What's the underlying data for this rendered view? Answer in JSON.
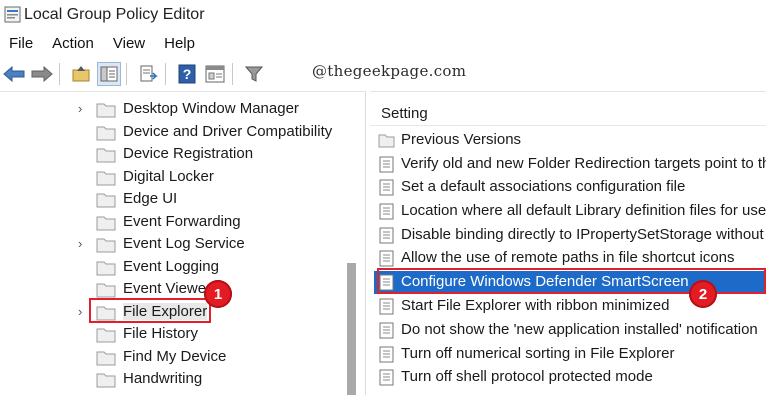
{
  "window": {
    "title": "Local Group Policy Editor"
  },
  "menu": [
    "File",
    "Action",
    "View",
    "Help"
  ],
  "toolbar": {
    "buttons": [
      "back-arrow-icon",
      "forward-arrow-icon",
      "up-folder-icon",
      "show-hide-tree-icon",
      "export-list-icon",
      "help-icon",
      "properties-icon",
      "filter-icon"
    ]
  },
  "watermark": "@thegeekpage.com",
  "tree": {
    "items": [
      {
        "label": "Desktop Window Manager",
        "expandable": true
      },
      {
        "label": "Device and Driver Compatibility",
        "expandable": false
      },
      {
        "label": "Device Registration",
        "expandable": false
      },
      {
        "label": "Digital Locker",
        "expandable": false
      },
      {
        "label": "Edge UI",
        "expandable": false
      },
      {
        "label": "Event Forwarding",
        "expandable": false
      },
      {
        "label": "Event Log Service",
        "expandable": true
      },
      {
        "label": "Event Logging",
        "expandable": false
      },
      {
        "label": "Event Viewer",
        "expandable": false
      },
      {
        "label": "File Explorer",
        "expandable": true,
        "selected": true
      },
      {
        "label": "File History",
        "expandable": false
      },
      {
        "label": "Find My Device",
        "expandable": false
      },
      {
        "label": "Handwriting",
        "expandable": false
      }
    ]
  },
  "settings": {
    "column_header": "Setting",
    "items": [
      {
        "label": "Previous Versions",
        "type": "folder"
      },
      {
        "label": "Verify old and new Folder Redirection targets point to th",
        "type": "policy"
      },
      {
        "label": "Set a default associations configuration file",
        "type": "policy"
      },
      {
        "label": "Location where all default Library definition files for user",
        "type": "policy"
      },
      {
        "label": "Disable binding directly to IPropertySetStorage without i",
        "type": "policy"
      },
      {
        "label": "Allow the use of remote paths in file shortcut icons",
        "type": "policy"
      },
      {
        "label": "Configure Windows Defender SmartScreen",
        "type": "policy",
        "highlighted": true
      },
      {
        "label": "Start File Explorer with ribbon minimized",
        "type": "policy"
      },
      {
        "label": "Do not show the 'new application installed' notification",
        "type": "policy"
      },
      {
        "label": "Turn off numerical sorting in File Explorer",
        "type": "policy"
      },
      {
        "label": "Turn off shell protocol protected mode",
        "type": "policy"
      }
    ]
  },
  "annotations": {
    "badge1": "1",
    "badge2": "2"
  },
  "colors": {
    "highlight": "#1d6ac8",
    "annotation_red": "#e31b23"
  }
}
